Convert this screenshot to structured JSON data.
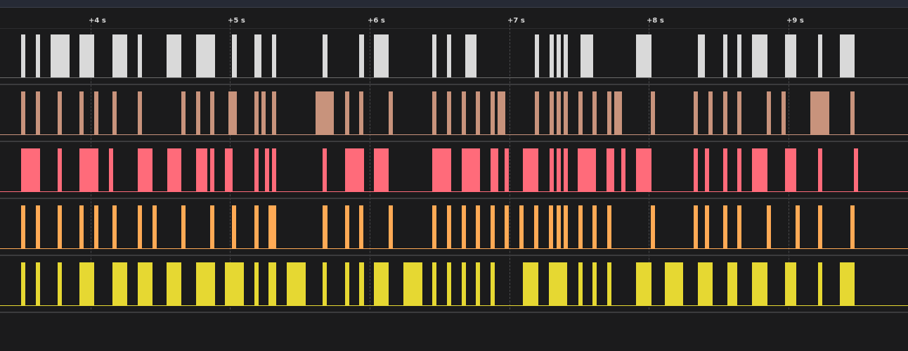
{
  "timeline": {
    "ticks": [
      "+4 s",
      "+5 s",
      "+6 s",
      "+7 s",
      "+8 s",
      "+9 s"
    ]
  },
  "tracks": [
    {
      "color": "#d9d9d9",
      "base_color": "#6a6a6a",
      "bars": [
        [
          30,
          36
        ],
        [
          51,
          57
        ],
        [
          72,
          99
        ],
        [
          113,
          134
        ],
        [
          160,
          181
        ],
        [
          196,
          202
        ],
        [
          237,
          258
        ],
        [
          279,
          306
        ],
        [
          330,
          337
        ],
        [
          362,
          372
        ],
        [
          387,
          393
        ],
        [
          459,
          466
        ],
        [
          511,
          518
        ],
        [
          532,
          553
        ],
        [
          615,
          621
        ],
        [
          636,
          642
        ],
        [
          662,
          678
        ],
        [
          761,
          767
        ],
        [
          782,
          788
        ],
        [
          792,
          798
        ],
        [
          802,
          808
        ],
        [
          826,
          844
        ],
        [
          905,
          927
        ],
        [
          993,
          1003
        ],
        [
          1029,
          1035
        ],
        [
          1049,
          1055
        ],
        [
          1070,
          1092
        ],
        [
          1117,
          1133
        ],
        [
          1164,
          1170
        ],
        [
          1195,
          1216
        ]
      ]
    },
    {
      "color": "#c8937c",
      "base_color": "#c8937c",
      "bars": [
        [
          30,
          36
        ],
        [
          51,
          57
        ],
        [
          82,
          88
        ],
        [
          113,
          119
        ],
        [
          134,
          140
        ],
        [
          160,
          166
        ],
        [
          196,
          202
        ],
        [
          258,
          264
        ],
        [
          279,
          285
        ],
        [
          299,
          305
        ],
        [
          325,
          337
        ],
        [
          362,
          368
        ],
        [
          372,
          378
        ],
        [
          387,
          393
        ],
        [
          449,
          475
        ],
        [
          491,
          497
        ],
        [
          511,
          517
        ],
        [
          553,
          559
        ],
        [
          615,
          621
        ],
        [
          636,
          642
        ],
        [
          657,
          663
        ],
        [
          677,
          683
        ],
        [
          698,
          704
        ],
        [
          708,
          719
        ],
        [
          761,
          767
        ],
        [
          782,
          788
        ],
        [
          792,
          798
        ],
        [
          802,
          808
        ],
        [
          823,
          829
        ],
        [
          843,
          849
        ],
        [
          864,
          870
        ],
        [
          874,
          885
        ],
        [
          926,
          932
        ],
        [
          987,
          993
        ],
        [
          1008,
          1014
        ],
        [
          1029,
          1035
        ],
        [
          1049,
          1055
        ],
        [
          1091,
          1097
        ],
        [
          1112,
          1118
        ],
        [
          1153,
          1180
        ],
        [
          1210,
          1216
        ]
      ]
    },
    {
      "color": "#ff6b7a",
      "base_color": "#ff6b7a",
      "bars": [
        [
          30,
          57
        ],
        [
          82,
          88
        ],
        [
          113,
          140
        ],
        [
          155,
          161
        ],
        [
          196,
          217
        ],
        [
          238,
          258
        ],
        [
          279,
          295
        ],
        [
          299,
          305
        ],
        [
          320,
          326
        ],
        [
          325,
          331
        ],
        [
          362,
          368
        ],
        [
          377,
          383
        ],
        [
          387,
          393
        ],
        [
          459,
          465
        ],
        [
          491,
          518
        ],
        [
          532,
          553
        ],
        [
          615,
          642
        ],
        [
          657,
          683
        ],
        [
          698,
          709
        ],
        [
          718,
          724
        ],
        [
          744,
          766
        ],
        [
          782,
          788
        ],
        [
          792,
          798
        ],
        [
          802,
          808
        ],
        [
          822,
          848
        ],
        [
          863,
          874
        ],
        [
          884,
          890
        ],
        [
          905,
          927
        ],
        [
          987,
          993
        ],
        [
          1003,
          1009
        ],
        [
          1029,
          1035
        ],
        [
          1049,
          1055
        ],
        [
          1070,
          1092
        ],
        [
          1117,
          1133
        ],
        [
          1164,
          1170
        ],
        [
          1215,
          1221
        ]
      ]
    },
    {
      "color": "#ffaa55",
      "base_color": "#ffaa55",
      "bars": [
        [
          30,
          36
        ],
        [
          51,
          57
        ],
        [
          82,
          88
        ],
        [
          113,
          119
        ],
        [
          134,
          140
        ],
        [
          160,
          166
        ],
        [
          196,
          202
        ],
        [
          217,
          223
        ],
        [
          258,
          264
        ],
        [
          299,
          305
        ],
        [
          330,
          336
        ],
        [
          362,
          368
        ],
        [
          382,
          393
        ],
        [
          459,
          466
        ],
        [
          491,
          497
        ],
        [
          511,
          517
        ],
        [
          553,
          559
        ],
        [
          615,
          621
        ],
        [
          636,
          642
        ],
        [
          657,
          663
        ],
        [
          677,
          683
        ],
        [
          698,
          704
        ],
        [
          718,
          724
        ],
        [
          739,
          745
        ],
        [
          760,
          766
        ],
        [
          781,
          787
        ],
        [
          792,
          798
        ],
        [
          802,
          808
        ],
        [
          823,
          829
        ],
        [
          843,
          849
        ],
        [
          864,
          870
        ],
        [
          926,
          932
        ],
        [
          987,
          993
        ],
        [
          1003,
          1009
        ],
        [
          1029,
          1035
        ],
        [
          1049,
          1055
        ],
        [
          1091,
          1097
        ],
        [
          1132,
          1138
        ],
        [
          1164,
          1170
        ],
        [
          1210,
          1216
        ]
      ]
    },
    {
      "color": "#e6d832",
      "base_color": "#e6d832",
      "bars": [
        [
          30,
          36
        ],
        [
          51,
          57
        ],
        [
          82,
          88
        ],
        [
          113,
          134
        ],
        [
          160,
          181
        ],
        [
          196,
          217
        ],
        [
          237,
          258
        ],
        [
          279,
          306
        ],
        [
          320,
          347
        ],
        [
          362,
          368
        ],
        [
          382,
          393
        ],
        [
          408,
          435
        ],
        [
          459,
          465
        ],
        [
          491,
          497
        ],
        [
          511,
          518
        ],
        [
          532,
          553
        ],
        [
          574,
          601
        ],
        [
          615,
          621
        ],
        [
          636,
          642
        ],
        [
          657,
          663
        ],
        [
          677,
          683
        ],
        [
          698,
          704
        ],
        [
          744,
          766
        ],
        [
          781,
          807
        ],
        [
          823,
          829
        ],
        [
          843,
          849
        ],
        [
          864,
          870
        ],
        [
          905,
          927
        ],
        [
          946,
          972
        ],
        [
          993,
          1014
        ],
        [
          1035,
          1049
        ],
        [
          1070,
          1092
        ],
        [
          1117,
          1133
        ],
        [
          1164,
          1170
        ],
        [
          1195,
          1216
        ]
      ]
    }
  ]
}
